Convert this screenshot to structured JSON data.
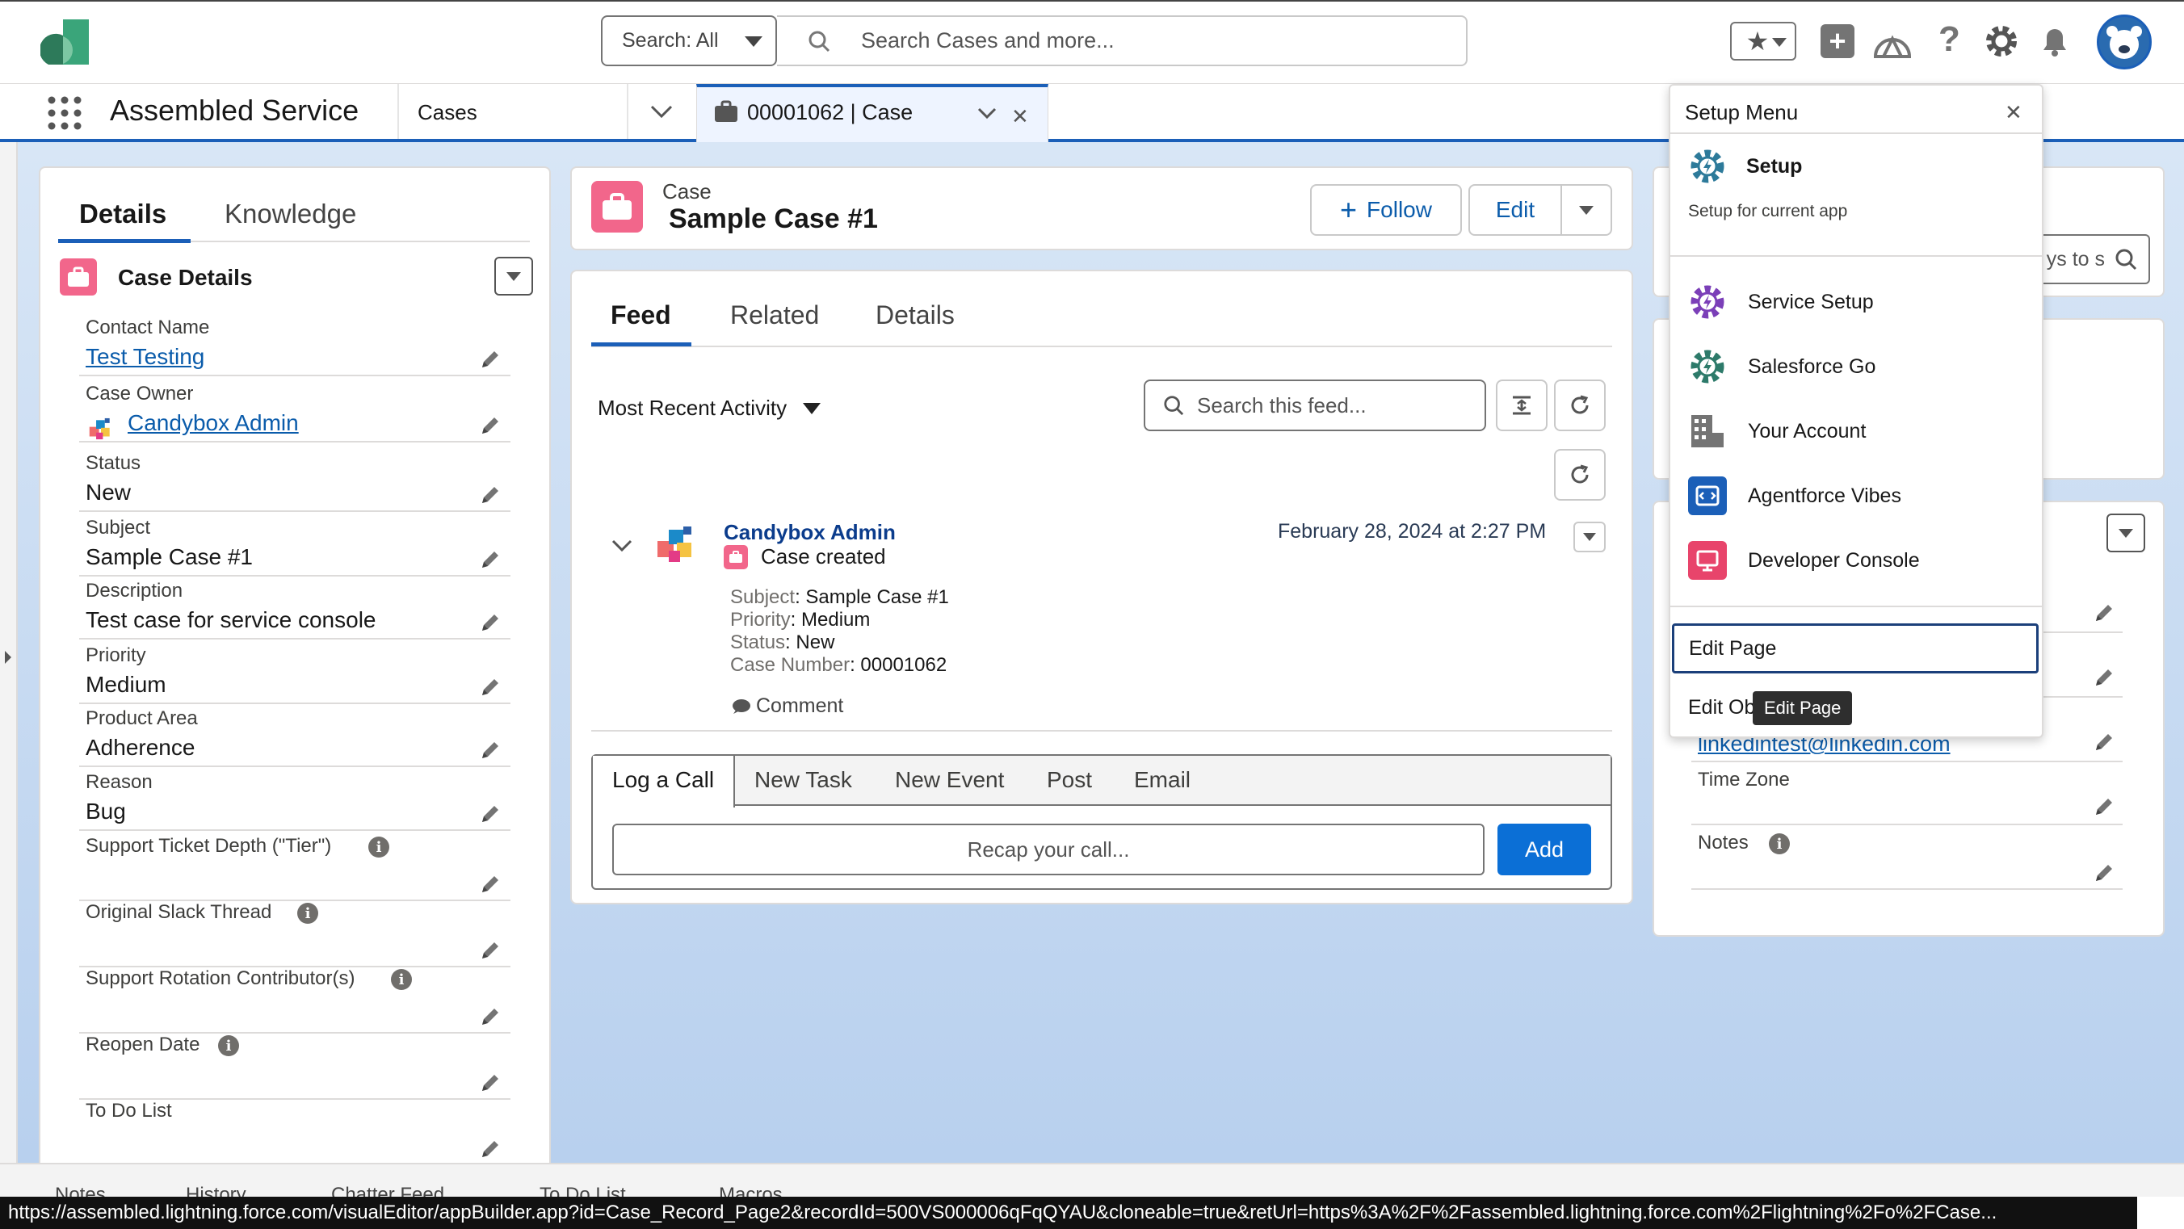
{
  "header": {
    "search_scope": "Search: All",
    "search_placeholder": "Search Cases and more..."
  },
  "nav": {
    "app_name": "Assembled Service",
    "object_tab": "Cases",
    "record_tab": "00001062 | Case"
  },
  "left_panel": {
    "tabs": [
      "Details",
      "Knowledge"
    ],
    "section_title": "Case Details",
    "fields": [
      {
        "label": "Contact Name",
        "value": "Test Testing"
      },
      {
        "label": "Case Owner",
        "value": "Candybox Admin"
      },
      {
        "label": "Status",
        "value": "New"
      },
      {
        "label": "Subject",
        "value": "Sample Case #1"
      },
      {
        "label": "Description",
        "value": "Test case for service console"
      },
      {
        "label": "Priority",
        "value": "Medium"
      },
      {
        "label": "Product Area",
        "value": "Adherence"
      },
      {
        "label": "Reason",
        "value": "Bug"
      },
      {
        "label": "Support Ticket Depth (\"Tier\")",
        "value": ""
      },
      {
        "label": "Original Slack Thread",
        "value": ""
      },
      {
        "label": "Support Rotation Contributor(s)",
        "value": ""
      },
      {
        "label": "Reopen Date",
        "value": ""
      },
      {
        "label": "To Do List",
        "value": ""
      }
    ]
  },
  "record_header": {
    "object_label": "Case",
    "title": "Sample Case #1",
    "follow_label": "Follow",
    "edit_label": "Edit"
  },
  "feed": {
    "tabs": [
      "Feed",
      "Related",
      "Details"
    ],
    "sort_label": "Most Recent Activity",
    "search_placeholder": "Search this feed...",
    "post": {
      "author": "Candybox Admin",
      "action": "Case created",
      "timestamp": "February 28, 2024 at 2:27 PM",
      "details": [
        {
          "k": "Subject",
          "v": "Sample Case #1"
        },
        {
          "k": "Priority",
          "v": "Medium"
        },
        {
          "k": "Status",
          "v": "New"
        },
        {
          "k": "Case Number",
          "v": "00001062"
        }
      ],
      "comment_label": "Comment"
    },
    "publisher_tabs": [
      "Log a Call",
      "New Task",
      "New Event",
      "Post",
      "Email"
    ],
    "recap_placeholder": "Recap your call...",
    "add_label": "Add"
  },
  "right_panel": {
    "search_partial": "ys to s",
    "email_value": "linkedintest@linkedin.com",
    "time_zone_label": "Time Zone",
    "notes_label": "Notes"
  },
  "setup_menu": {
    "title": "Setup Menu",
    "setup_label": "Setup",
    "setup_sub": "Setup for current app",
    "items": [
      "Service Setup",
      "Salesforce Go",
      "Your Account",
      "Agentforce Vibes",
      "Developer Console"
    ],
    "edit_page": "Edit Page",
    "edit_object_partial": "Edit Ob",
    "tooltip": "Edit Page"
  },
  "utility_bar": [
    "Notes",
    "History",
    "Chatter Feed",
    "To Do List",
    "Macros"
  ],
  "status_url": "https://assembled.lightning.force.com/visualEditor/appBuilder.app?id=Case_Record_Page2&recordId=500VS000006qFqQYAU&cloneable=true&retUrl=https%3A%2F%2Fassembled.lightning.force.com%2Flightning%2Fo%2FCase..."
}
